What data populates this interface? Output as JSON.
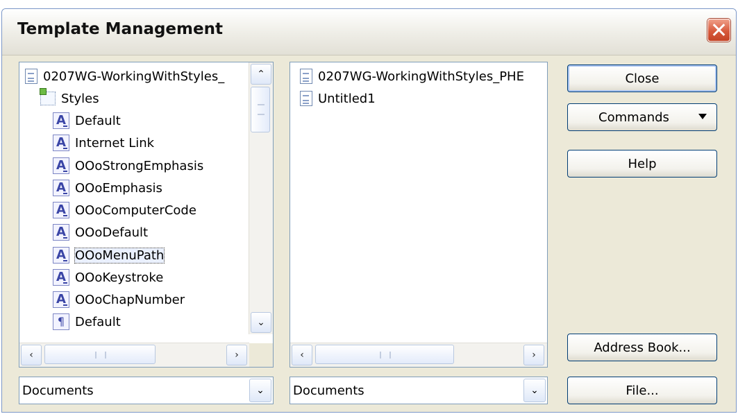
{
  "window": {
    "title": "Template Management"
  },
  "left_list": {
    "items": [
      {
        "label": "0207WG-WorkingWithStyles_",
        "icon": "document-icon",
        "indent": 0
      },
      {
        "label": "Styles",
        "icon": "styles-folder-icon",
        "indent": 1
      },
      {
        "label": "Default",
        "icon": "character-style-icon",
        "indent": 2
      },
      {
        "label": "Internet Link",
        "icon": "character-style-icon",
        "indent": 2
      },
      {
        "label": "OOoStrongEmphasis",
        "icon": "character-style-icon",
        "indent": 2
      },
      {
        "label": "OOoEmphasis",
        "icon": "character-style-icon",
        "indent": 2
      },
      {
        "label": "OOoComputerCode",
        "icon": "character-style-icon",
        "indent": 2
      },
      {
        "label": "OOoDefault",
        "icon": "character-style-icon",
        "indent": 2
      },
      {
        "label": "OOoMenuPath",
        "icon": "character-style-icon",
        "indent": 2,
        "selected": true
      },
      {
        "label": "OOoKeystroke",
        "icon": "character-style-icon",
        "indent": 2
      },
      {
        "label": "OOoChapNumber",
        "icon": "character-style-icon",
        "indent": 2
      },
      {
        "label": "Default",
        "icon": "paragraph-style-icon",
        "indent": 2
      }
    ]
  },
  "right_list": {
    "items": [
      {
        "label": "0207WG-WorkingWithStyles_PHE",
        "icon": "document-icon"
      },
      {
        "label": "Untitled1",
        "icon": "document-icon"
      }
    ]
  },
  "scroll": {
    "up": "⌃",
    "down": "⌄",
    "left": "‹",
    "right": "›",
    "grip_v": "≡",
    "grip_h": "III"
  },
  "left_combo": {
    "value": "Documents",
    "arrow": "⌄"
  },
  "right_combo": {
    "value": "Documents",
    "arrow": "⌄"
  },
  "buttons": {
    "close": "Close",
    "commands": "Commands",
    "help": "Help",
    "address_book": "Address Book...",
    "file": "File..."
  },
  "colors": {
    "dialog_bg": "#ece9d8",
    "button_border": "#003c74",
    "close_button": "#d75a3c",
    "list_border": "#7f9db9"
  }
}
